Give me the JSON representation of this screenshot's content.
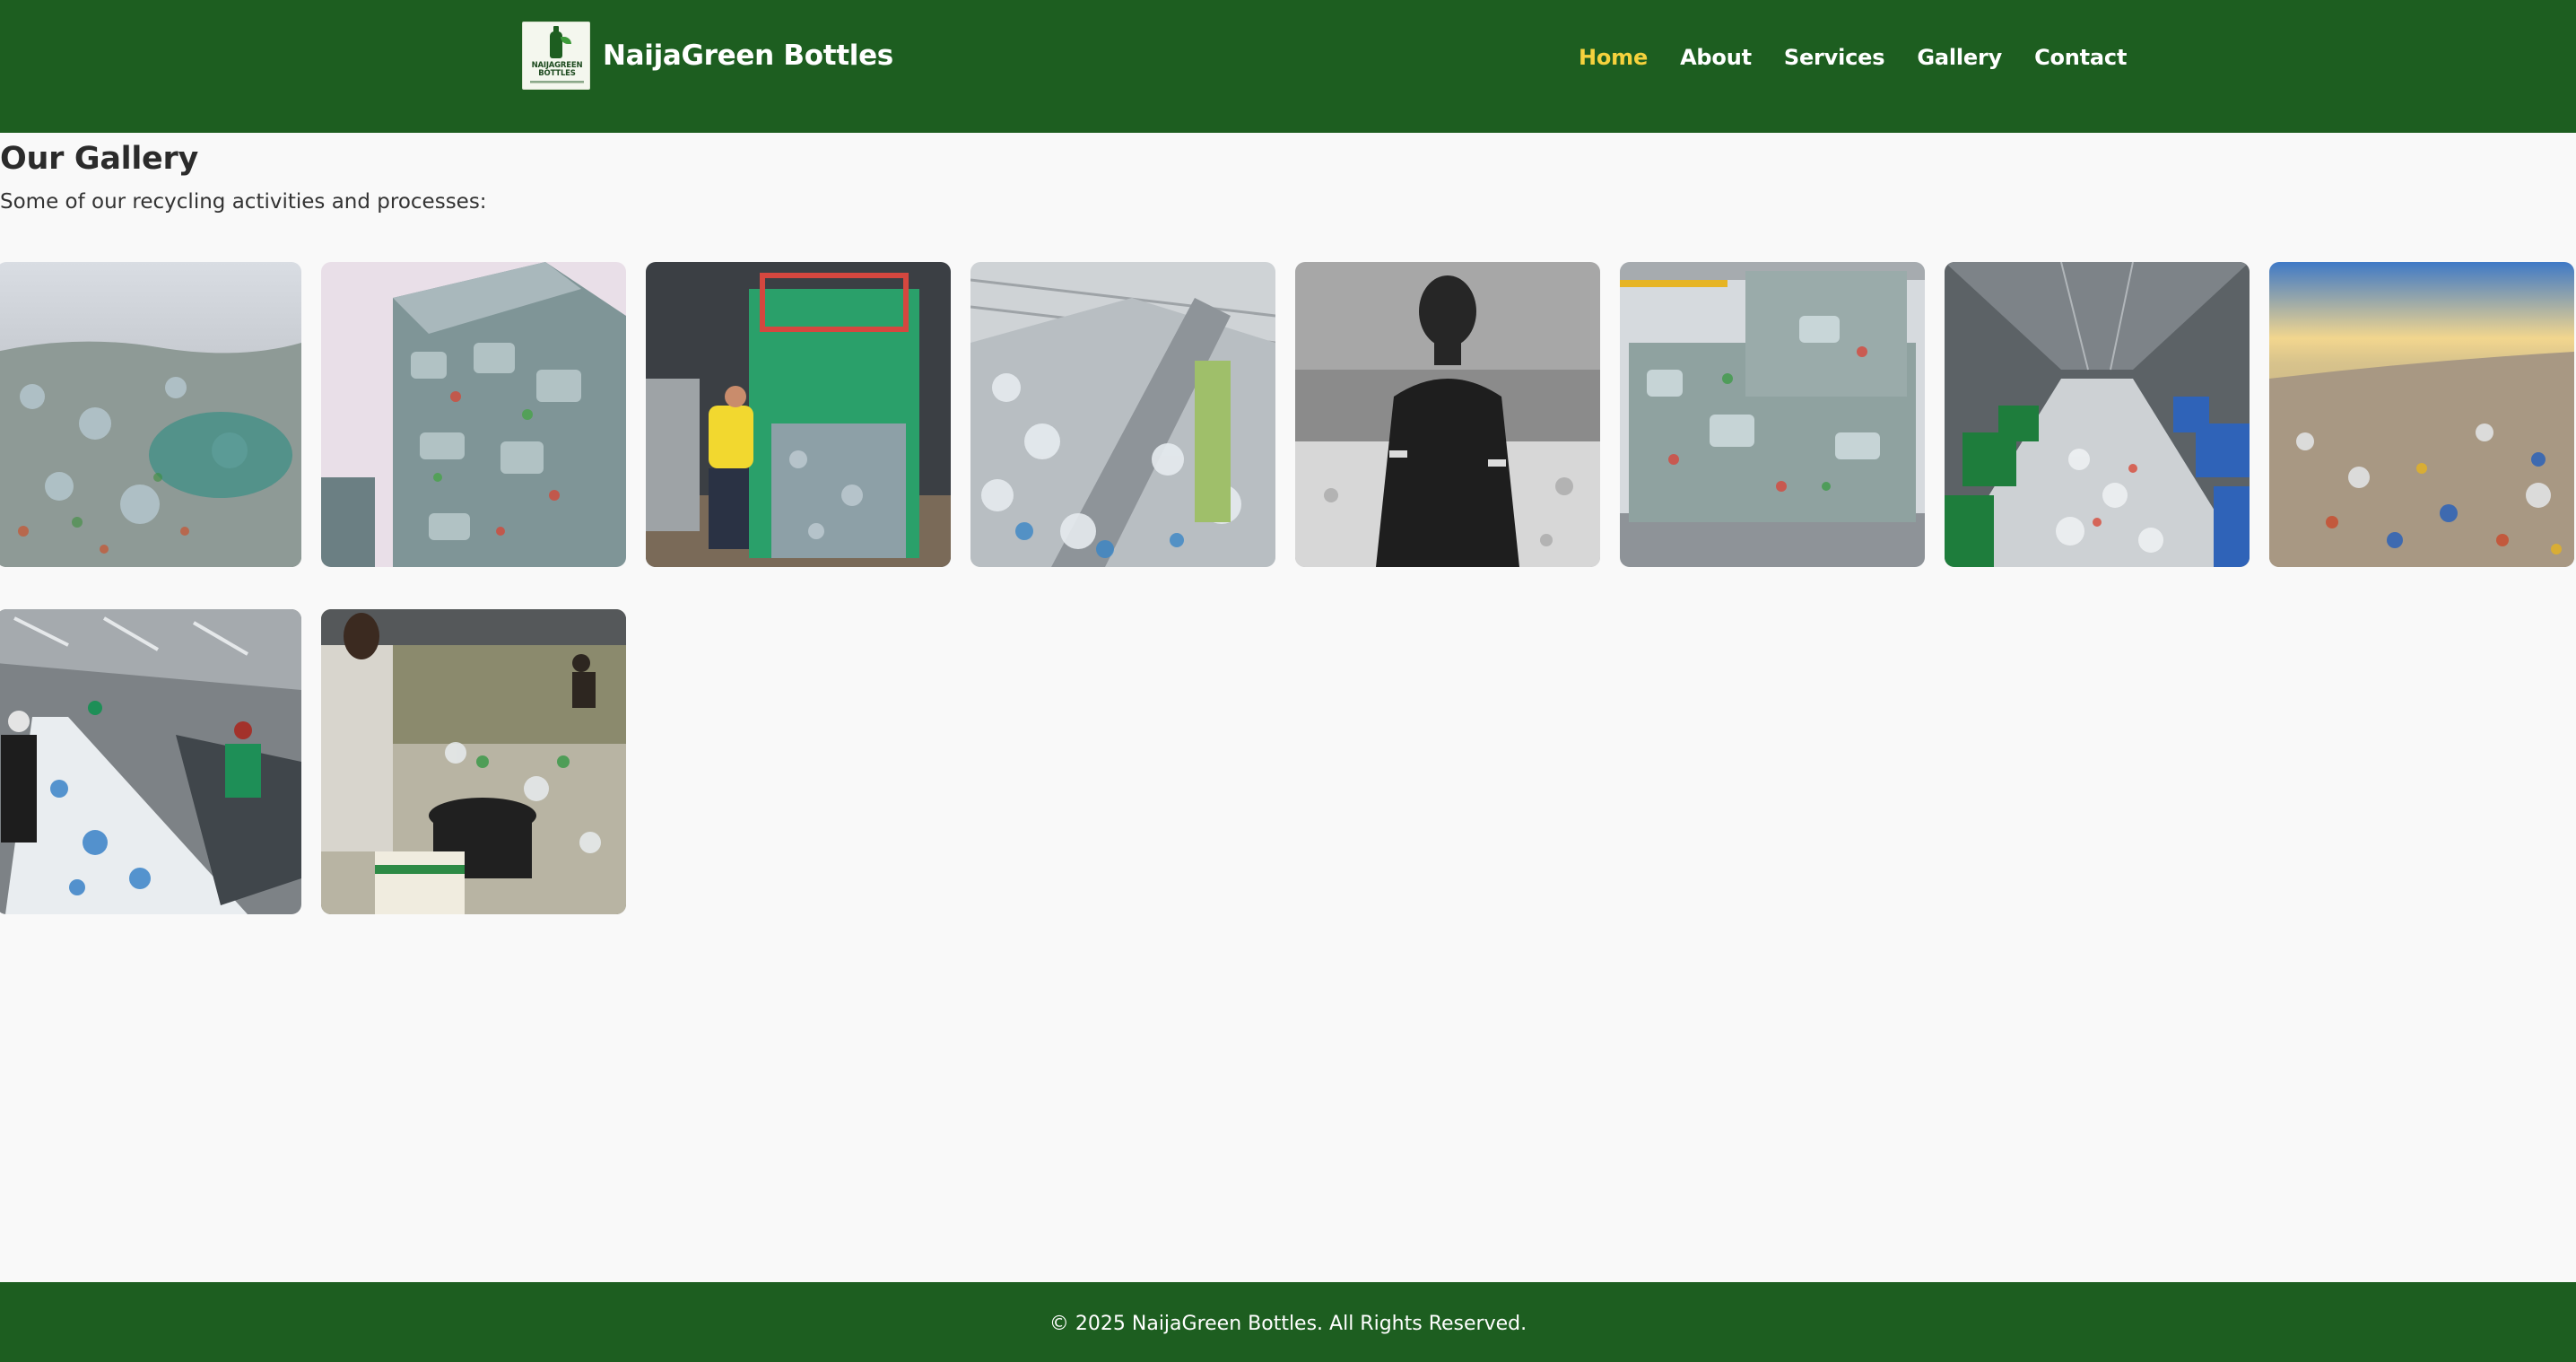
{
  "header": {
    "logo_text": "NAIJAGREEN BOTTLES",
    "brand_name": "NaijaGreen Bottles",
    "nav": [
      {
        "label": "Home",
        "active": true
      },
      {
        "label": "About",
        "active": false
      },
      {
        "label": "Services",
        "active": false
      },
      {
        "label": "Gallery",
        "active": false
      },
      {
        "label": "Contact",
        "active": false
      }
    ]
  },
  "main": {
    "title": "Our Gallery",
    "subtitle": "Some of our recycling activities and processes:",
    "gallery": [
      {
        "icon": "plastic-bottle-dump-image"
      },
      {
        "icon": "baled-bottles-stack-image"
      },
      {
        "icon": "baling-machine-worker-image"
      },
      {
        "icon": "conveyor-belt-bottles-image"
      },
      {
        "icon": "worker-portrait-grayscale-image"
      },
      {
        "icon": "compressed-bales-warehouse-image"
      },
      {
        "icon": "warehouse-bins-aisle-image"
      },
      {
        "icon": "bottle-field-sunset-image"
      },
      {
        "icon": "sorting-line-workers-image"
      },
      {
        "icon": "manual-bottle-collection-image"
      }
    ]
  },
  "footer": {
    "copyright": "© 2025 NaijaGreen Bottles. All Rights Reserved."
  },
  "colors": {
    "header_bg": "#1d5e20",
    "nav_active": "#f6d23d",
    "page_bg": "#f9f9f9"
  }
}
